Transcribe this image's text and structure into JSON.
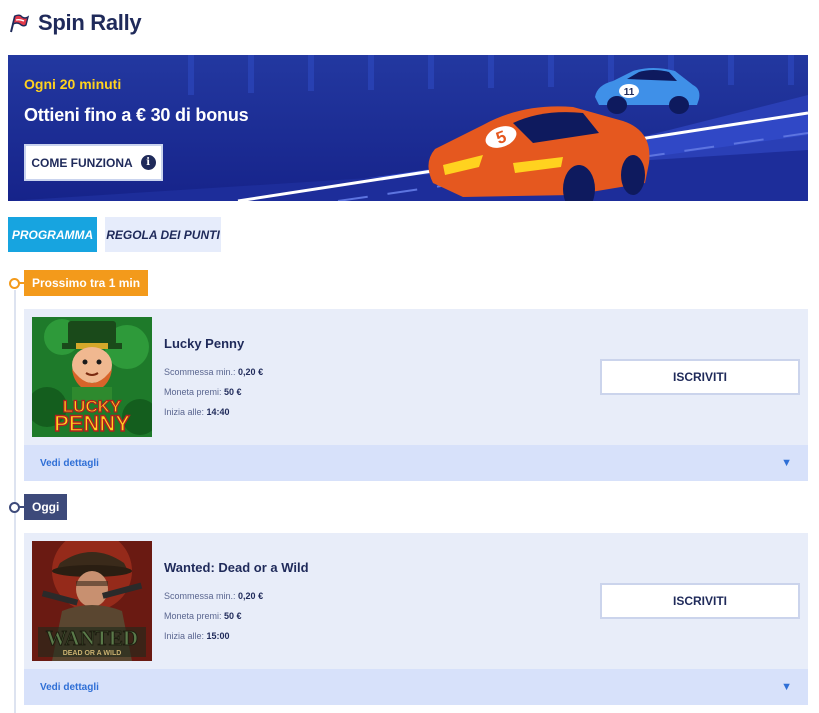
{
  "header": {
    "title": "Spin Rally",
    "icon": "flag-icon"
  },
  "banner": {
    "subtitle": "Ogni 20 minuti",
    "headline": "Ottieni fino a € 30 di bonus",
    "how_button": "COME FUNZIONA",
    "info_icon_text": "i",
    "car_front_number": "5",
    "car_back_number": "11"
  },
  "tabs": [
    {
      "label": "PROGRAMMA",
      "active": true
    },
    {
      "label": "REGOLA DEI PUNTI",
      "active": false
    }
  ],
  "sections": [
    {
      "badge": "Prossimo tra 1 min",
      "color": "#f39a1b",
      "game": {
        "title": "Lucky Penny",
        "thumb_line1": "LUCKY",
        "thumb_line2": "PENNY",
        "min_bet_label": "Scommessa min.:",
        "min_bet_value": "0,20 €",
        "prize_label": "Moneta premi:",
        "prize_value": "50 €",
        "start_label": "Inizia alle:",
        "start_value": "14:40",
        "join_label": "ISCRIVITI",
        "details_label": "Vedi dettagli"
      }
    },
    {
      "badge": "Oggi",
      "color": "#3d4a7a",
      "game": {
        "title": "Wanted: Dead or a Wild",
        "thumb_line1": "WANTED",
        "thumb_line2": "DEAD OR A WILD",
        "min_bet_label": "Scommessa min.:",
        "min_bet_value": "0,20 €",
        "prize_label": "Moneta premi:",
        "prize_value": "50 €",
        "start_label": "Inizia alle:",
        "start_value": "15:00",
        "join_label": "ISCRIVITI",
        "details_label": "Vedi dettagli"
      }
    }
  ]
}
